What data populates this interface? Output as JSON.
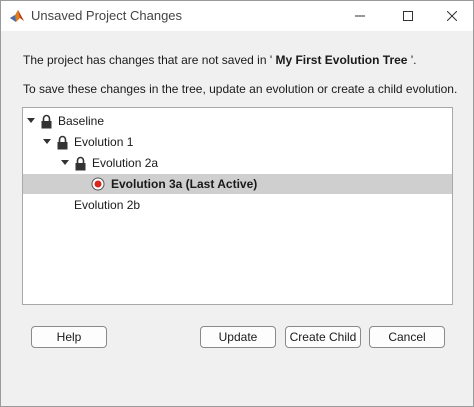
{
  "window": {
    "title": "Unsaved Project Changes",
    "icons": {
      "app": "matlab-icon",
      "minimize": "minimize-icon",
      "maximize": "maximize-icon",
      "close": "close-icon"
    }
  },
  "message": {
    "line1_prefix": "The project has changes that are not saved in ' ",
    "project_name": "My First Evolution Tree",
    "line1_suffix": " '.",
    "line2": "To save these changes in the tree, update an evolution or create a child evolution."
  },
  "tree": {
    "nodes": [
      {
        "label": "Baseline",
        "expanded": true,
        "locked": true
      },
      {
        "label": "Evolution 1",
        "expanded": true,
        "locked": true
      },
      {
        "label": "Evolution 2a",
        "expanded": true,
        "locked": true
      },
      {
        "label": "Evolution 3a (Last Active)",
        "selected": true,
        "active": true
      },
      {
        "label": "Evolution 2b"
      }
    ]
  },
  "buttons": {
    "help": "Help",
    "update": "Update",
    "create_child": "Create Child",
    "cancel": "Cancel"
  },
  "colors": {
    "selection": "#cfcfcf",
    "active_dot": "#d9261c"
  }
}
